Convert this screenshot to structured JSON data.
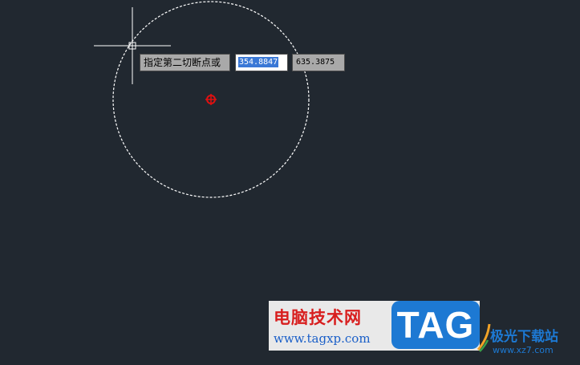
{
  "colors": {
    "background": "#212830",
    "crosshair": "#ffffff",
    "circle_preview": "#ffffff",
    "center_marker": "#e01010",
    "selection": "#3a78d6",
    "tag_blue": "#1d79d3",
    "watermark_red": "#d81e1e"
  },
  "dynamic_input": {
    "prompt": "指定第二切断点或",
    "x_value": "354.8847",
    "y_value": "635.3875"
  },
  "watermark": {
    "title": "电脑技术网",
    "url": "www.tagxp.com",
    "logo_text": "TAG",
    "brand_name": "极光下载站",
    "brand_url": "www.xz7.com"
  }
}
